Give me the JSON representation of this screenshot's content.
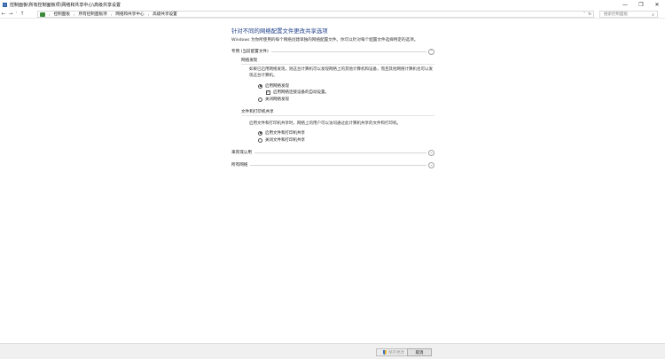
{
  "window": {
    "title": "控制面板\\所有控制面板项\\网络和共享中心\\高级共享设置",
    "minimize": "—",
    "maximize": "❐",
    "close": "✕"
  },
  "nav": {
    "back": "←",
    "forward": "→",
    "recent": "˅",
    "up": "↑",
    "breadcrumbs": [
      "控制面板",
      "所有控制面板项",
      "网络和共享中心",
      "高级共享设置"
    ],
    "separator": "›",
    "dropdown": "˅",
    "refresh": "↻",
    "search_placeholder": "搜索控制面板",
    "search_icon": "⌕"
  },
  "main": {
    "heading": "针对不同的网络配置文件更改共享选项",
    "description": "Windows 为你所使用的每个网络创建单独的网络配置文件。你可以针对每个配置文件选择特定的选项。",
    "private_profile": {
      "label": "专用 (当前配置文件)",
      "chevron": "⌃",
      "network_discovery": {
        "label": "网络发现",
        "description": "如果已启用网络发现，则这台计算机可以发现网络上的其他计算机和设备，而且其他网络计算机也可以发现这台计算机。",
        "options": [
          {
            "label": "启用网络发现",
            "selected": true
          },
          {
            "label": "关闭网络发现",
            "selected": false
          }
        ],
        "auto_setup": {
          "label": "启用网络连接设备的自动设置。",
          "checked": true,
          "mark": "✓"
        }
      },
      "file_printer_sharing": {
        "label": "文件和打印机共享",
        "description": "启用文件和打印机共享时，网络上的用户可以访问通过此计算机共享的文件和打印机。",
        "options": [
          {
            "label": "启用文件和打印机共享",
            "selected": true
          },
          {
            "label": "关闭文件和打印机共享",
            "selected": false
          }
        ]
      }
    },
    "guest_public": {
      "label": "来宾或公用",
      "chevron": "⌄"
    },
    "all_networks": {
      "label": "所有网络",
      "chevron": "⌄"
    }
  },
  "footer": {
    "save": "保存更改",
    "cancel": "取消"
  }
}
